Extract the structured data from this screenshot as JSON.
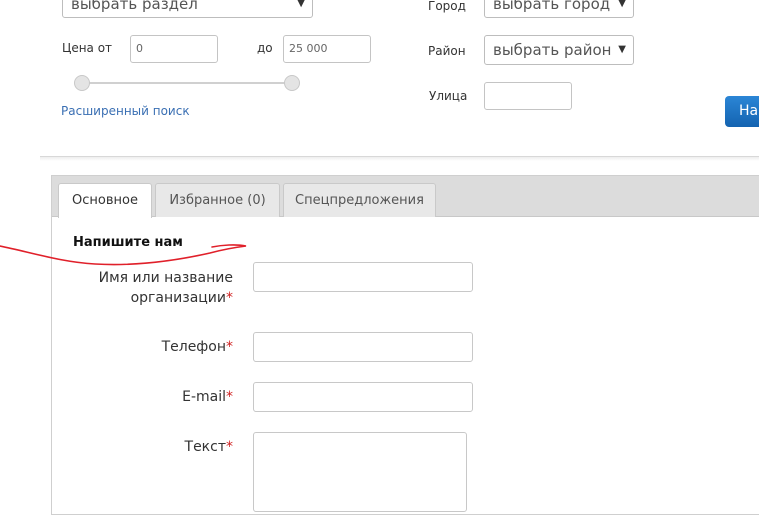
{
  "filters": {
    "section_select": "выбрать раздел",
    "price_from_label": "Цена от",
    "price_from_value": "0",
    "price_to_label": "до",
    "price_to_value": "25 000",
    "advanced_search": "Расширенный поиск",
    "city_label": "Город",
    "city_select": "выбрать город",
    "district_label": "Район",
    "district_select": "выбрать район",
    "street_label": "Улица",
    "street_value": "",
    "find_button": "Найти"
  },
  "tabs": [
    {
      "label": "Основное",
      "active": true
    },
    {
      "label": "Избранное (0)",
      "active": false
    },
    {
      "label": "Спецпредложения",
      "active": false
    }
  ],
  "form": {
    "title": "Напишите нам",
    "name_label_1": "Имя или название",
    "name_label_2": "организации",
    "phone_label": "Телефон",
    "email_label": "E-mail",
    "text_label": "Текст",
    "required_mark": "*"
  },
  "colors": {
    "link": "#3a6fb3",
    "button": "#1a6fc2",
    "required": "#d02020",
    "annotation": "#e0202a"
  }
}
